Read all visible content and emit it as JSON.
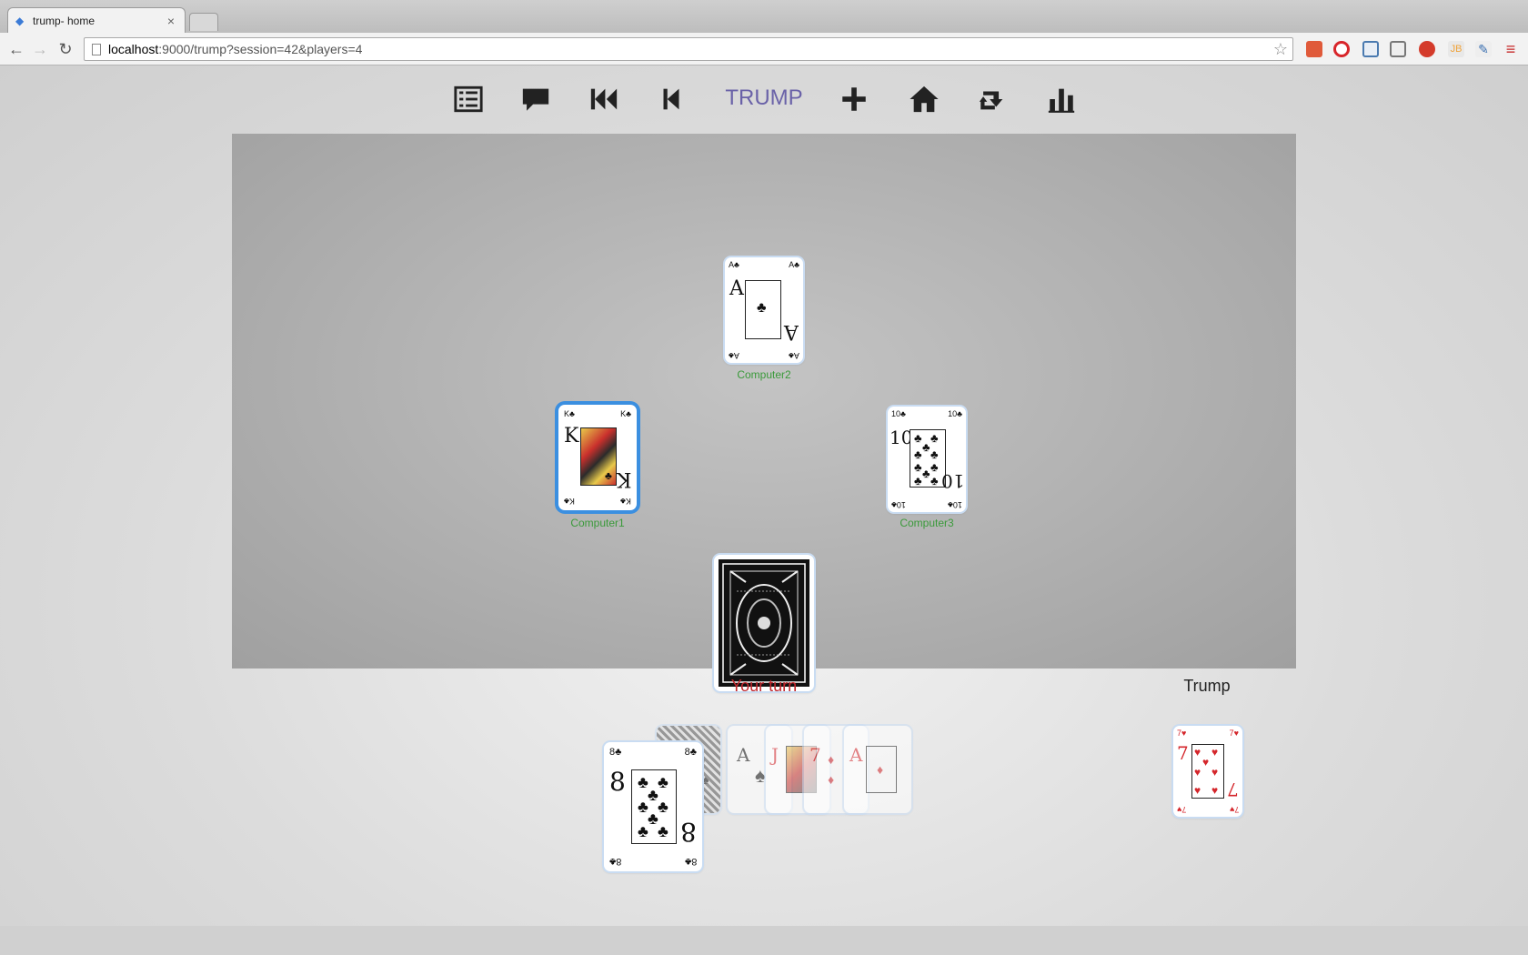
{
  "browser": {
    "tab_title": "trump- home",
    "tab_favicon": "angular-icon",
    "url_host": "localhost",
    "url_path": ":9000/trump?session=42&players=4"
  },
  "menu": {
    "items": [
      {
        "name": "list-icon"
      },
      {
        "name": "chat-icon"
      },
      {
        "name": "fast-backward-icon"
      },
      {
        "name": "step-backward-icon"
      },
      {
        "name": "plus-icon"
      },
      {
        "name": "home-icon"
      },
      {
        "name": "retweet-icon"
      },
      {
        "name": "bar-chart-icon"
      }
    ],
    "title": "TRUMP"
  },
  "table": {
    "players": [
      {
        "name": "Computer2",
        "card": {
          "rank": "A",
          "suit": "♣"
        }
      },
      {
        "name": "Computer1",
        "card": {
          "rank": "K",
          "suit": "♣"
        }
      },
      {
        "name": "Computer3",
        "card": {
          "rank": "10",
          "suit": "♣"
        }
      }
    ],
    "deck_label": "deck-back"
  },
  "status": {
    "your_turn": "Your turn",
    "trump_label": "Trump"
  },
  "hand": {
    "front_card": {
      "rank": "8",
      "suit": "♣"
    },
    "ghost_cards": [
      {
        "rank": "8",
        "suit": "♠"
      },
      {
        "rank": "A",
        "suit": "♠"
      },
      {
        "rank": "J",
        "suit": "♦"
      },
      {
        "rank": "7",
        "suit": "♦"
      },
      {
        "rank": "A",
        "suit": "♦"
      }
    ]
  },
  "trump_card": {
    "rank": "7",
    "suit": "♥"
  },
  "colors": {
    "title_purple": "#6a62a8",
    "turn_red": "#c2272d",
    "player_green": "#3a9a3a",
    "selected_blue": "#3b8fe0"
  }
}
